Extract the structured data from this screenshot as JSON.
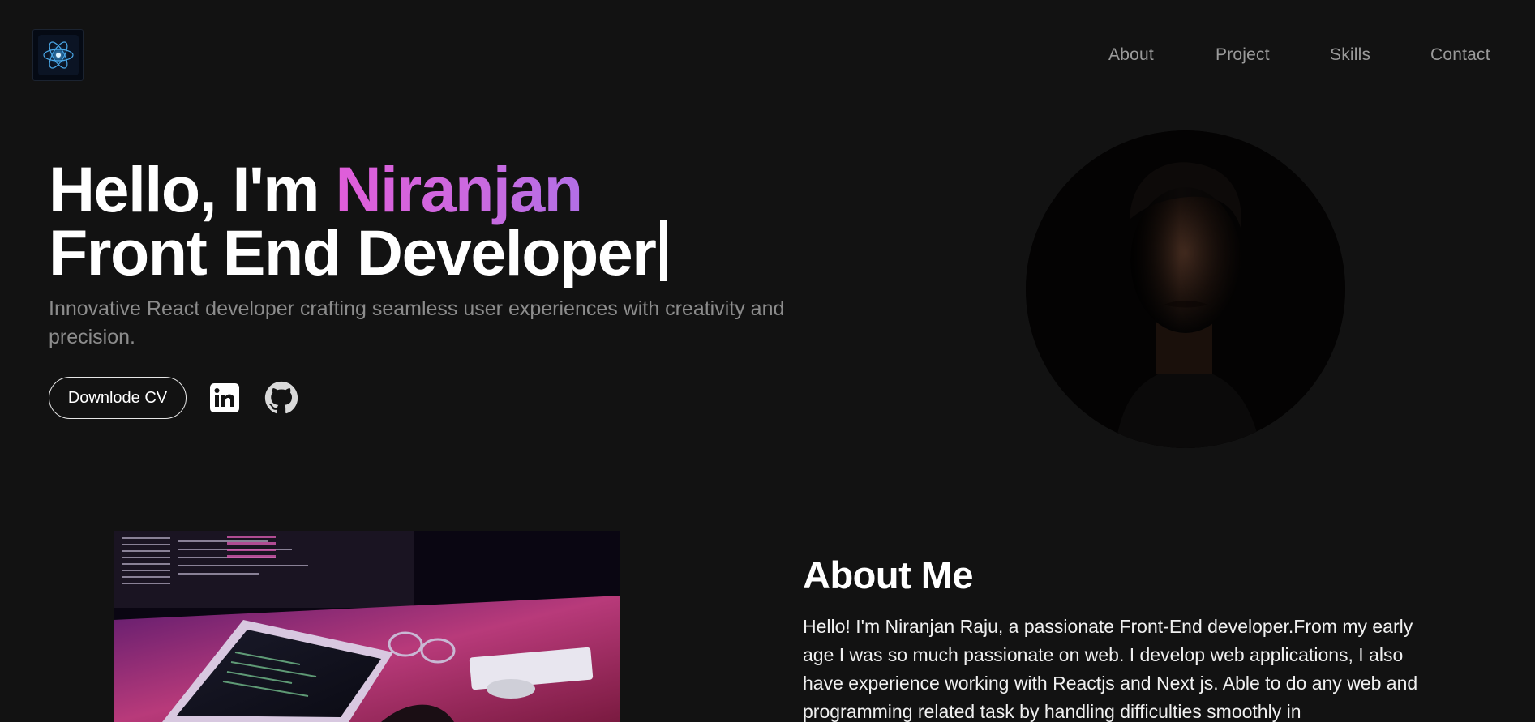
{
  "nav": {
    "about": "About",
    "project": "Project",
    "skills": "Skills",
    "contact": "Contact"
  },
  "hero": {
    "greeting": "Hello, I'm ",
    "name": "Niranjan",
    "role": "Front End Developer",
    "subtitle": "Innovative React developer crafting seamless user experiences with creativity and precision.",
    "cv_button": "Downlode CV"
  },
  "about": {
    "title": "About Me",
    "text": "Hello! I'm Niranjan Raju, a passionate Front-End developer.From my early age I was so much passionate on web. I develop web applications, I also have experience working with Reactjs and Next js. Able to do any web and programming related task by handling difficulties smoothly in"
  },
  "colors": {
    "background": "#121212",
    "name_gradient_start": "#e05dd9",
    "name_gradient_end": "#b26fe6",
    "nav_text": "#9a9a9a",
    "subtitle_text": "#8c8c8c"
  },
  "icons": {
    "logo": "react-atom-icon",
    "linkedin": "linkedin-icon",
    "github": "github-icon"
  }
}
